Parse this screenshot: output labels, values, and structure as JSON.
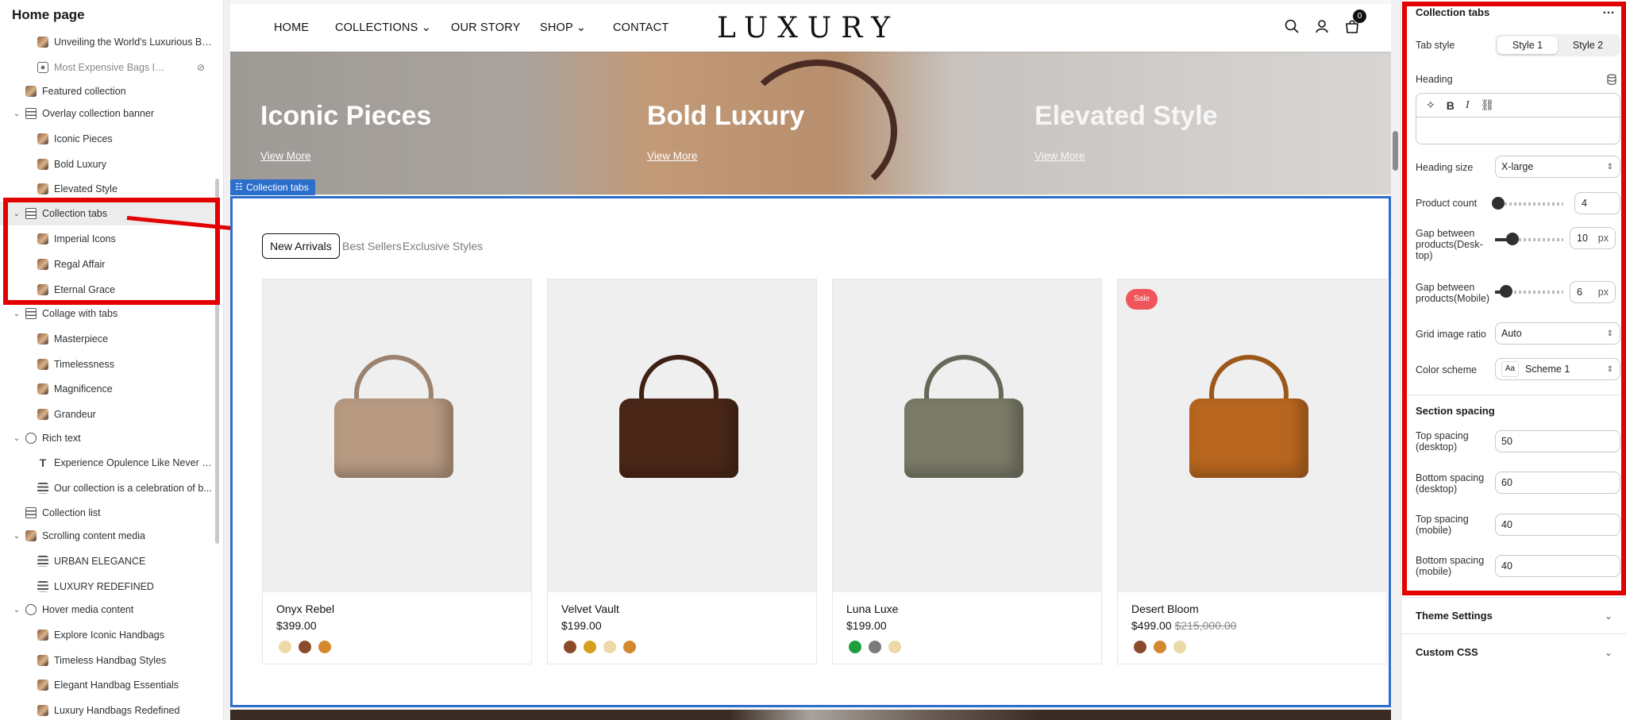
{
  "left_panel": {
    "title": "Home page",
    "rows": [
      {
        "label": "Unveiling the World's Luxurious Ba...",
        "icon": "thumbnail",
        "indent": 2,
        "chev": ""
      },
      {
        "label": "Most Expensive Bags In T...",
        "icon": "hidden-block-icon",
        "indent": 2,
        "chev": "",
        "muted": true
      },
      {
        "label": "Featured collection",
        "icon": "thumbnail",
        "indent": 1,
        "chev": ""
      },
      {
        "label": "Overlay collection banner",
        "icon": "section-icon",
        "indent": 1,
        "chev": "⌄"
      },
      {
        "label": "Iconic Pieces",
        "icon": "thumbnail",
        "indent": 2,
        "chev": ""
      },
      {
        "label": "Bold Luxury",
        "icon": "thumbnail",
        "indent": 2,
        "chev": ""
      },
      {
        "label": "Elevated Style",
        "icon": "thumbnail",
        "indent": 2,
        "chev": ""
      },
      {
        "label": "Collection tabs",
        "icon": "section-icon",
        "indent": 1,
        "chev": "⌄",
        "selected": true
      },
      {
        "label": "Imperial Icons",
        "icon": "thumbnail",
        "indent": 2,
        "chev": ""
      },
      {
        "label": "Regal Affair",
        "icon": "thumbnail",
        "indent": 2,
        "chev": ""
      },
      {
        "label": "Eternal Grace",
        "icon": "thumbnail",
        "indent": 2,
        "chev": ""
      },
      {
        "label": "Collage with tabs",
        "icon": "section-icon",
        "indent": 1,
        "chev": "⌄"
      },
      {
        "label": "Masterpiece",
        "icon": "thumbnail",
        "indent": 2,
        "chev": ""
      },
      {
        "label": "Timelessness",
        "icon": "thumbnail",
        "indent": 2,
        "chev": ""
      },
      {
        "label": "Magnificence",
        "icon": "thumbnail",
        "indent": 2,
        "chev": ""
      },
      {
        "label": "Grandeur",
        "icon": "thumbnail",
        "indent": 2,
        "chev": ""
      },
      {
        "label": "Rich text",
        "icon": "rich-text-icon",
        "indent": 1,
        "chev": "⌄"
      },
      {
        "label": "Experience Opulence Like Never B...",
        "icon": "text-icon",
        "indent": 2,
        "chev": ""
      },
      {
        "label": "Our collection is a celebration of b...",
        "icon": "paragraph-icon",
        "indent": 2,
        "chev": ""
      },
      {
        "label": "Collection list",
        "icon": "section-icon",
        "indent": 1,
        "chev": ""
      },
      {
        "label": "Scrolling content media",
        "icon": "thumbnail",
        "indent": 1,
        "chev": "⌄"
      },
      {
        "label": "URBAN ELEGANCE",
        "icon": "paragraph-icon",
        "indent": 2,
        "chev": ""
      },
      {
        "label": "LUXURY REDEFINED",
        "icon": "paragraph-icon",
        "indent": 2,
        "chev": ""
      },
      {
        "label": "Hover media content",
        "icon": "rich-text-icon",
        "indent": 1,
        "chev": "⌄"
      },
      {
        "label": "Explore Iconic Handbags",
        "icon": "thumbnail",
        "indent": 2,
        "chev": ""
      },
      {
        "label": "Timeless Handbag Styles",
        "icon": "thumbnail",
        "indent": 2,
        "chev": ""
      },
      {
        "label": "Elegant Handbag Essentials",
        "icon": "thumbnail",
        "indent": 2,
        "chev": ""
      },
      {
        "label": "Luxury Handbags Redefined",
        "icon": "thumbnail",
        "indent": 2,
        "chev": ""
      }
    ]
  },
  "store": {
    "nav": [
      {
        "label": "HOME",
        "caret": false
      },
      {
        "label": "COLLECTIONS",
        "caret": true
      },
      {
        "label": "OUR STORY",
        "caret": false
      },
      {
        "label": "SHOP",
        "caret": true
      },
      {
        "label": "CONTACT",
        "caret": false
      }
    ],
    "logo": "LUXURY",
    "cart_count": "0",
    "banner": [
      {
        "title": "Iconic Pieces",
        "link": "View More"
      },
      {
        "title": "Bold Luxury",
        "link": "View More"
      },
      {
        "title": "Elevated Style",
        "link": "View More"
      }
    ],
    "section_tag": "Collection tabs",
    "tabs": [
      "New Arrivals",
      "Best Sellers",
      "Exclusive Styles"
    ],
    "active_tab": 0,
    "products": [
      {
        "name": "Onyx Rebel",
        "price": "$399.00",
        "old_price": "",
        "sale": "",
        "swatches": [
          "#ecd9a6",
          "#8c4a2c",
          "#d4892f"
        ],
        "bag_color": "#b89a82"
      },
      {
        "name": "Velvet Vault",
        "price": "$199.00",
        "old_price": "",
        "sale": "",
        "swatches": [
          "#8c4a2c",
          "#d69f1f",
          "#ecd9a6",
          "#d4892f"
        ],
        "bag_color": "#4a2718"
      },
      {
        "name": "Luna Luxe",
        "price": "$199.00",
        "old_price": "",
        "sale": "",
        "swatches": [
          "#1e9f3d",
          "#7a7a7a",
          "#ecd9a6"
        ],
        "bag_color": "#7a7a68"
      },
      {
        "name": "Desert Bloom",
        "price": "$499.00",
        "old_price": "$215,000.00",
        "sale": "Sale",
        "swatches": [
          "#8c4a2c",
          "#d4892f",
          "#ecd9a6"
        ],
        "bag_color": "#b8661f"
      }
    ]
  },
  "settings": {
    "title": "Collection tabs",
    "more_icon": "…",
    "tab_style_label": "Tab style",
    "tab_style_options": [
      "Style 1",
      "Style 2"
    ],
    "tab_style_selected": 0,
    "heading_label": "Heading",
    "heading_value": "",
    "heading_size_label": "Heading size",
    "heading_size_value": "X-large",
    "product_count_label": "Product count",
    "product_count_value": "4",
    "gap_desktop_label": "Gap between products(Desk-top)",
    "gap_desktop_value": "10",
    "gap_mobile_label": "Gap between products(Mobile)",
    "gap_mobile_value": "6",
    "unit": "px",
    "grid_ratio_label": "Grid image ratio",
    "grid_ratio_value": "Auto",
    "color_scheme_label": "Color scheme",
    "color_scheme_value": "Scheme 1",
    "color_scheme_badge": "Aa",
    "section_spacing_heading": "Section spacing",
    "top_desktop_label": "Top spacing (desktop)",
    "top_desktop_value": "50",
    "bottom_desktop_label": "Bottom spacing (desktop)",
    "bottom_desktop_value": "60",
    "top_mobile_label": "Top spacing (mobile)",
    "top_mobile_value": "40",
    "bottom_mobile_label": "Bottom spacing (mobile)",
    "bottom_mobile_value": "40",
    "theme_settings": "Theme Settings",
    "custom_css": "Custom CSS"
  },
  "colors": {
    "highlight": "#e30000",
    "selection": "#2c6ecb",
    "sale": "#f0555b"
  }
}
